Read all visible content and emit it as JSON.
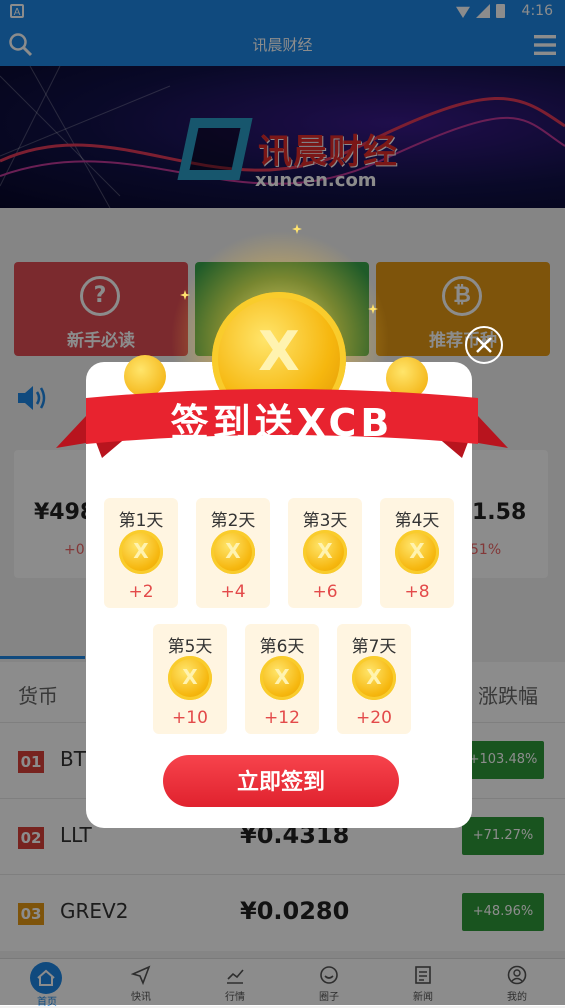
{
  "status": {
    "time": "4:16",
    "left_icon": "A"
  },
  "header": {
    "title": "讯晨财经"
  },
  "banner": {
    "brand": "讯晨财经",
    "domain": "xuncen.com"
  },
  "quick": [
    {
      "label": "新手必读",
      "icon": "?",
      "color": "#e04e55"
    },
    {
      "label": "",
      "icon": "",
      "color": "#3aa64b"
    },
    {
      "label": "推荐币种",
      "icon": "₿",
      "color": "#e59a14"
    }
  ],
  "prices": [
    {
      "value": "¥498",
      "change": "+0"
    },
    {
      "value": "1.58",
      "change": "51%"
    }
  ],
  "list": {
    "header_left": "货币",
    "header_right": "涨跌幅",
    "rows": [
      {
        "rank": "01",
        "name": "BT",
        "price": "",
        "change": "+103.48%",
        "rank_color": "#d9413a"
      },
      {
        "rank": "02",
        "name": "LLT",
        "price": "¥0.4318",
        "change": "+71.27%",
        "rank_color": "#d9413a"
      },
      {
        "rank": "03",
        "name": "GREV2",
        "price": "¥0.0280",
        "change": "+48.96%",
        "rank_color": "#e59a14"
      }
    ]
  },
  "nav": [
    {
      "label": "首页",
      "icon": "home-icon"
    },
    {
      "label": "快讯",
      "icon": "send-icon"
    },
    {
      "label": "行情",
      "icon": "chart-icon"
    },
    {
      "label": "圈子",
      "icon": "chat-icon"
    },
    {
      "label": "新闻",
      "icon": "news-icon"
    },
    {
      "label": "我的",
      "icon": "user-icon"
    }
  ],
  "modal": {
    "title": "签到送XCB",
    "coin_letter": "X",
    "days": [
      {
        "label": "第1天",
        "reward": "+2"
      },
      {
        "label": "第2天",
        "reward": "+4"
      },
      {
        "label": "第3天",
        "reward": "+6"
      },
      {
        "label": "第4天",
        "reward": "+8"
      },
      {
        "label": "第5天",
        "reward": "+10"
      },
      {
        "label": "第6天",
        "reward": "+12"
      },
      {
        "label": "第7天",
        "reward": "+20"
      }
    ],
    "button": "立即签到"
  }
}
